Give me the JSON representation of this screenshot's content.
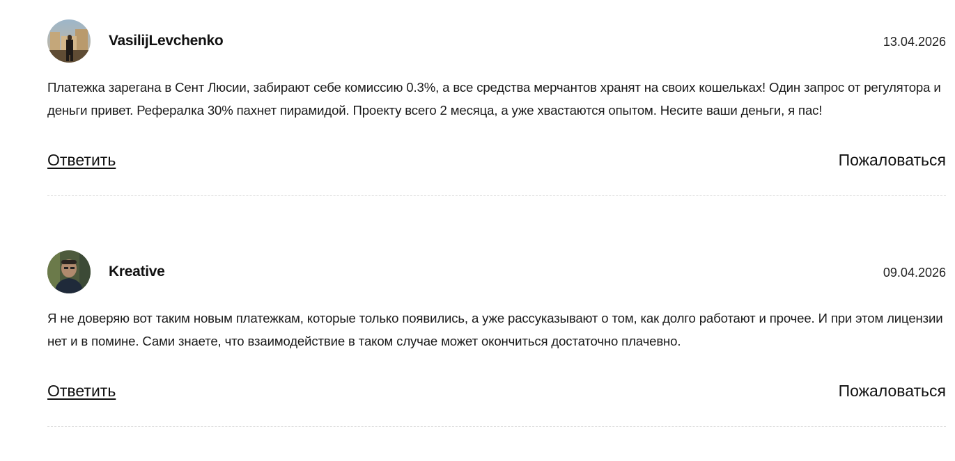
{
  "comments": [
    {
      "author": "VasilijLevchenko",
      "date": "13.04.2026",
      "text": "Платежка зарегана в Сент Люсии, забирают себе комиссию 0.3%, а все средства мерчантов хранят на своих кошельках! Один запрос от регулятора и деньги привет. Рефералка 30% пахнет пирамидой. Проекту всего 2 месяца, а уже хвастаются опытом. Несите ваши деньги, я пас!",
      "reply_label": "Ответить",
      "report_label": "Пожаловаться"
    },
    {
      "author": "Kreative",
      "date": "09.04.2026",
      "text": "Я не доверяю вот таким новым платежкам, которые только появились, а уже рассуказывают о том, как долго работают и прочее. И при этом лицензии нет и в помине. Сами знаете, что взаимодействие в таком случае может окончиться достаточно плачевно.",
      "reply_label": "Ответить",
      "report_label": "Пожаловаться"
    }
  ]
}
